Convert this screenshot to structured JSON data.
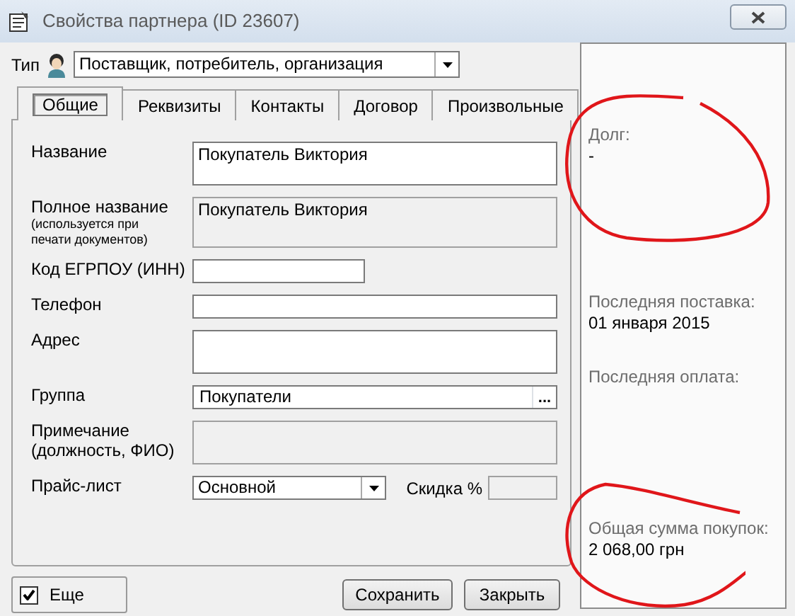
{
  "window": {
    "title": "Свойства партнера  (ID 23607)"
  },
  "type": {
    "label": "Тип",
    "value": "Поставщик, потребитель, организация"
  },
  "tabs": [
    {
      "label": "Общие",
      "selected": true
    },
    {
      "label": "Реквизиты",
      "selected": false
    },
    {
      "label": "Контакты",
      "selected": false
    },
    {
      "label": "Договор",
      "selected": false
    },
    {
      "label": "Произвольные",
      "selected": false
    }
  ],
  "fields": [
    {
      "kind": "multiline",
      "label": "Название",
      "value": "Покупатель Виктория",
      "disabled": false
    },
    {
      "kind": "multiline",
      "label": "Полное название",
      "note": "(используется при печати документов)",
      "value": "Покупатель Виктория",
      "disabled": true
    },
    {
      "kind": "short",
      "label": "Код ЕГРПОУ (ИНН)",
      "disabled": false
    },
    {
      "kind": "line",
      "label": "Телефон",
      "disabled": false
    },
    {
      "kind": "multiline",
      "label": "Адрес",
      "disabled": false
    },
    {
      "kind": "lookup",
      "label": "Группа",
      "value": "Покупатели",
      "button": "...",
      "disabled": false
    },
    {
      "kind": "multiline",
      "label": "Примечание (должность, ФИО)",
      "disabled": true
    },
    {
      "kind": "price",
      "label": "Прайс-лист",
      "value": "Основной",
      "discount_label": "Скидка %",
      "disabled": false
    }
  ],
  "more": {
    "label": "Еще",
    "checked": true
  },
  "buttons": [
    "Сохранить",
    "Закрыть"
  ],
  "info": [
    {
      "label": "Долг:",
      "value": "-"
    },
    {
      "label": "Последняя поставка:",
      "value": "01 января 2015"
    },
    {
      "label": "Последняя оплата:"
    },
    {
      "label": "Общая сумма покупок:",
      "value": "2 068,00 грн"
    }
  ]
}
